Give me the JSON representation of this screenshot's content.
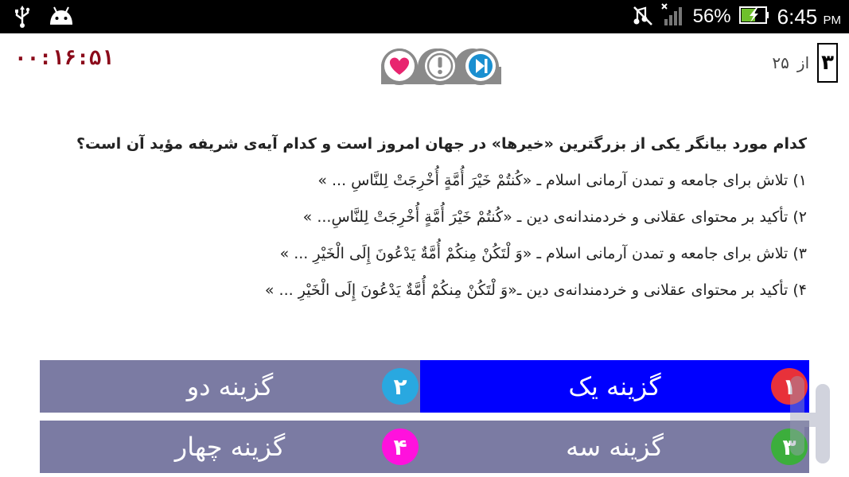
{
  "status_bar": {
    "battery": "56%",
    "time": "6:45",
    "ampm": "PM",
    "icons": [
      "usb-icon",
      "android-icon",
      "vibrate-icon",
      "signal-icon",
      "battery-charging-icon"
    ]
  },
  "header": {
    "timer": "۰۰:۱۶:۵۱",
    "current_question": "۳",
    "of_label": "از",
    "total_questions": "۲۵",
    "icons": [
      "heart-icon",
      "info-exclamation-icon",
      "skip-next-icon"
    ]
  },
  "question": {
    "text": "کدام مورد بیانگر یکی از بزرگترین «خیرها» در جهان امروز است و کدام آیه‌ی شریفه مؤید آن است؟",
    "options": [
      "۱) تلاش برای جامعه و تمدن آرمانی اسلام ـ «کُنتُمْ خَیْرَ أُمَّةٍ أُخْرِجَتْ لِلنَّاسِ ... »",
      "۲) تأکید بر محتوای عقلانی و خردمندانه‌ی دین ـ «کُنتُمْ خَیْرَ أُمَّةٍ أُخْرِجَتْ لِلنَّاسِ... »",
      "۳) تلاش برای جامعه و تمدن آرمانی اسلام ـ «وَ لْتَکُنْ مِنکُمْ أُمَّةٌ یَدْعُونَ إِلَی الْخَیْرِ ... »",
      "۴) تأکید بر محتوای عقلانی و خردمندانه‌ی دین ـ«وَ لْتَکُنْ مِنکُمْ أُمَّةٌ یَدْعُونَ إِلَی الْخَیْرِ ... »"
    ]
  },
  "answers": [
    {
      "label": "گزینه یک",
      "number": "۱",
      "badge_color": "#e8313a",
      "bg_color": "#0000ff",
      "selected": true
    },
    {
      "label": "گزینه دو",
      "number": "۲",
      "badge_color": "#29a8e0",
      "bg_color": "#7b7ba3",
      "selected": false
    },
    {
      "label": "گزینه سه",
      "number": "۳",
      "badge_color": "#3cae3c",
      "bg_color": "#7b7ba3",
      "selected": false
    },
    {
      "label": "گزینه چهار",
      "number": "۴",
      "badge_color": "#ff11dd",
      "bg_color": "#7b7ba3",
      "selected": false
    }
  ],
  "colors": {
    "timer": "#8b0a1a",
    "selected_answer": "#0000ff",
    "answer_bg": "#7b7ba3"
  }
}
